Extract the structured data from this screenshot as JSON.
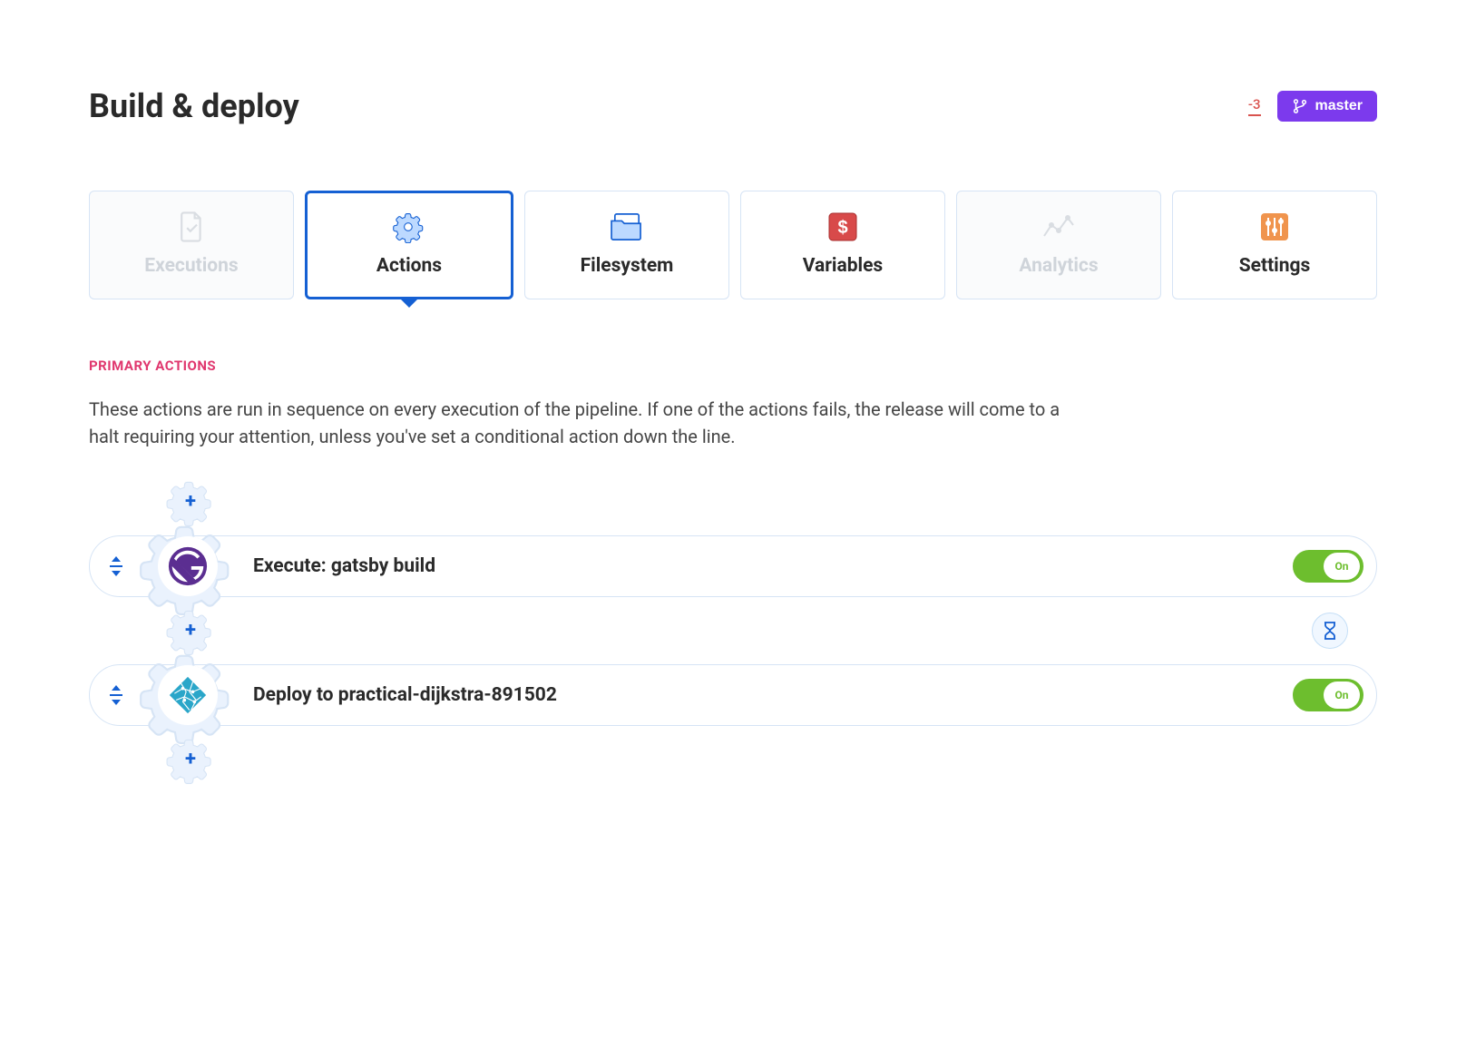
{
  "header": {
    "title": "Build & deploy",
    "badge": "-3",
    "branch": "master"
  },
  "tabs": [
    {
      "label": "Executions",
      "state": "disabled",
      "icon": "file-check"
    },
    {
      "label": "Actions",
      "state": "active",
      "icon": "gear"
    },
    {
      "label": "Filesystem",
      "state": "normal",
      "icon": "folders"
    },
    {
      "label": "Variables",
      "state": "normal",
      "icon": "dollar-box"
    },
    {
      "label": "Analytics",
      "state": "disabled",
      "icon": "chart"
    },
    {
      "label": "Settings",
      "state": "normal",
      "icon": "sliders"
    }
  ],
  "section": {
    "label": "PRIMARY ACTIONS",
    "description": "These actions are run in sequence on every execution of the pipeline. If one of the actions fails, the release will come to a halt requiring your attention, unless you've set a conditional action down the line."
  },
  "actions": [
    {
      "label": "Execute: gatsby build",
      "toggle": "On",
      "icon": "gatsby"
    },
    {
      "label": "Deploy to practical-dijkstra-891502",
      "toggle": "On",
      "icon": "netlify"
    }
  ],
  "wait_icon": "hourglass"
}
